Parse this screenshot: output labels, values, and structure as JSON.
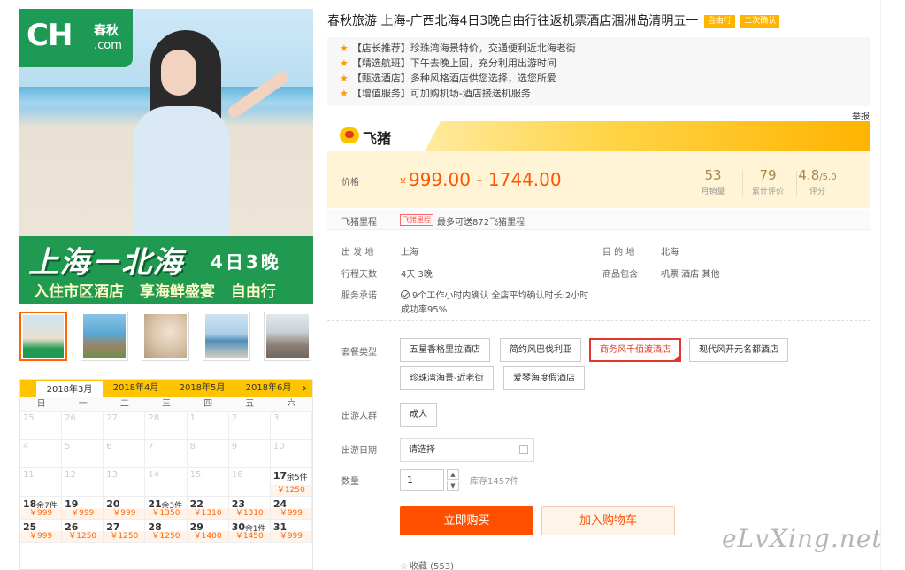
{
  "hero": {
    "logo_ch": "CH",
    "logo_cn": "春秋",
    "logo_com": ".com",
    "route": "上海－北海",
    "duration": "4日3晚",
    "highlights": "入住市区酒店 享海鲜盛宴 自由行"
  },
  "calendar": {
    "months": [
      "2018年3月",
      "2018年4月",
      "2018年5月",
      "2018年6月"
    ],
    "weekdays": [
      "日",
      "一",
      "二",
      "三",
      "四",
      "五",
      "六"
    ],
    "empty_rows": [
      [
        "25",
        "26",
        "27",
        "28",
        "1",
        "2",
        "3"
      ],
      [
        "4",
        "5",
        "6",
        "7",
        "8",
        "9",
        "10"
      ],
      [
        "11",
        "12",
        "13",
        "14",
        "15",
        "16"
      ]
    ],
    "d17": {
      "day": "17",
      "left": "余5件",
      "price": "￥1250"
    },
    "row4": [
      {
        "day": "18",
        "left": "余7件",
        "price": "￥999"
      },
      {
        "day": "19",
        "left": "",
        "price": "￥999"
      },
      {
        "day": "20",
        "left": "",
        "price": "￥999"
      },
      {
        "day": "21",
        "left": "余3件",
        "price": "￥1350"
      },
      {
        "day": "22",
        "left": "",
        "price": "￥1310"
      },
      {
        "day": "23",
        "left": "",
        "price": "￥1310"
      },
      {
        "day": "24",
        "left": "",
        "price": "￥999"
      }
    ],
    "row5": [
      {
        "day": "25",
        "left": "",
        "price": "￥999"
      },
      {
        "day": "26",
        "left": "",
        "price": "￥1250"
      },
      {
        "day": "27",
        "left": "",
        "price": "￥1250"
      },
      {
        "day": "28",
        "left": "",
        "price": "￥1250"
      },
      {
        "day": "29",
        "left": "",
        "price": "￥1400"
      },
      {
        "day": "30",
        "left": "余1件",
        "price": "￥1450"
      },
      {
        "day": "31",
        "left": "",
        "price": "￥999"
      }
    ]
  },
  "product": {
    "title": "春秋旅游 上海-广西北海4日3晚自由行往返机票酒店涠洲岛清明五一",
    "tags": [
      "自由行",
      "二次确认"
    ],
    "recommendations": [
      "【店长推荐】珍珠湾海景特价，交通便利近北海老街",
      "【精选航班】下午去晚上回，充分利用出游时间",
      "【甄选酒店】多种风格酒店供您选择，选您所爱",
      "【增值服务】可加购机场-酒店接送机服务"
    ],
    "report": "举报"
  },
  "fliggy": {
    "logo_text": "飞猪"
  },
  "price": {
    "label": "价格",
    "currency": "¥",
    "range": "999.00 - 1744.00",
    "monthly_sales": "53",
    "monthly_sales_label": "月销量",
    "reviews": "79",
    "reviews_label": "累计评价",
    "rating": "4.8",
    "rating_max": "/5.0",
    "rating_label": "评分"
  },
  "miles": {
    "label": "飞猪里程",
    "badge": "飞猪里程",
    "text": "最多可送872飞猪里程"
  },
  "details": {
    "from_label": "出 发 地",
    "from": "上海",
    "to_label": "目 的 地",
    "to": "北海",
    "days_label": "行程天数",
    "days": "4天  3晚",
    "includes_label": "商品包含",
    "includes": "机票  酒店  其他",
    "service_label": "服务承诺",
    "service_line1": "9个工作小时内确认 全店平均确认时长:2小时",
    "service_line2": "成功率95%"
  },
  "package": {
    "label": "套餐类型",
    "options": [
      "五星香格里拉酒店",
      "简约风巴伐利亚",
      "商务风千佰渡酒店",
      "现代风开元名都酒店",
      "珍珠湾海景-近老街",
      "爱琴海度假酒店"
    ],
    "selected": "商务风千佰渡酒店"
  },
  "crowd": {
    "label": "出游人群",
    "value": "成人"
  },
  "date": {
    "label": "出游日期",
    "placeholder": "请选择"
  },
  "quantity": {
    "label": "数量",
    "value": "1",
    "stock": "库存1457件"
  },
  "actions": {
    "buy": "立即购买",
    "cart": "加入购物车",
    "fav": "收藏 (553)"
  },
  "watermark": "eLvXing.net",
  "colors": {
    "accent": "#ff5000",
    "brand_green": "#1d9a55",
    "fliggy_yellow": "#ffc400"
  }
}
